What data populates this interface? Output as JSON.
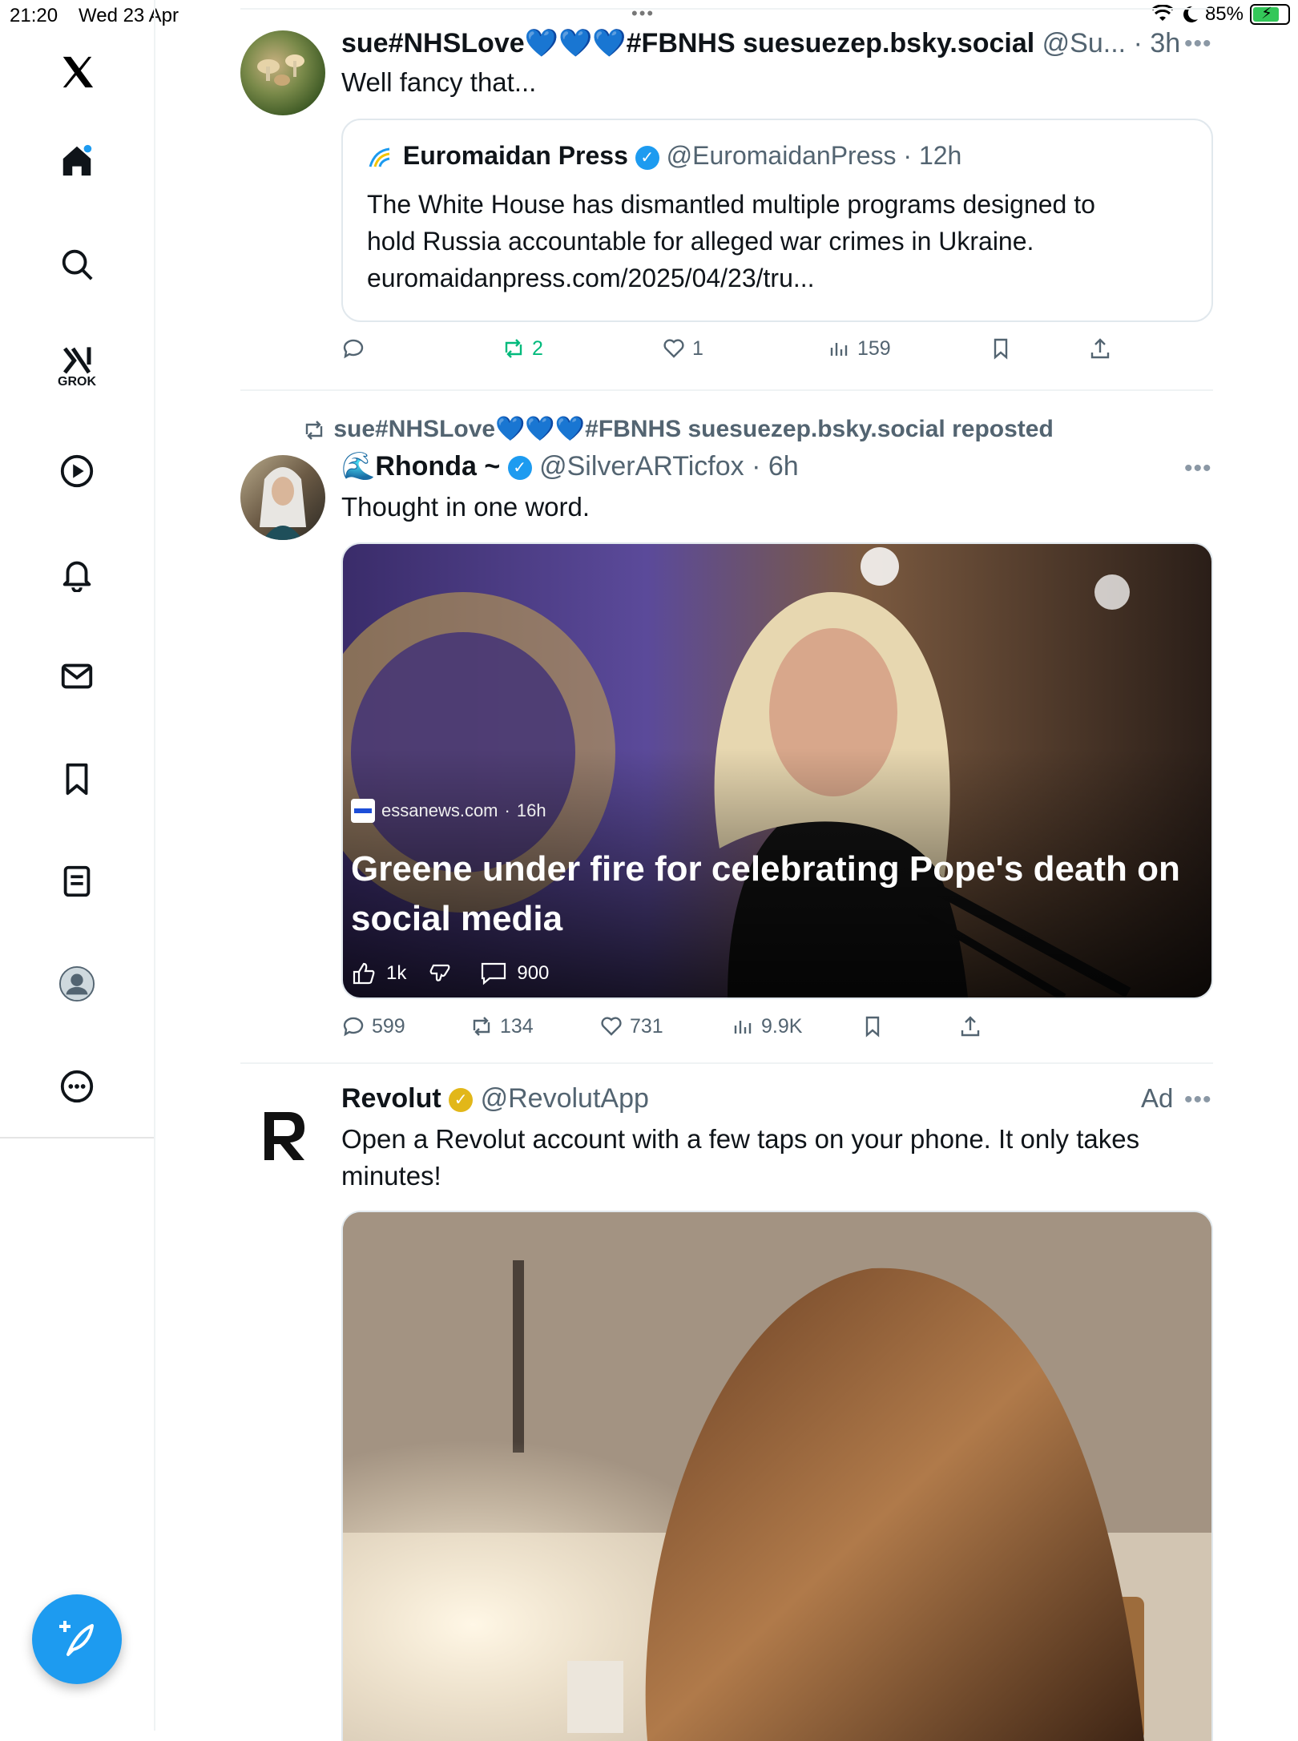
{
  "status_bar": {
    "time": "21:20",
    "date": "Wed 23 Apr",
    "battery": "85%",
    "battery_level": 0.85
  },
  "sidebar": {
    "grok_label": "GROK",
    "items": [
      {
        "icon": "x-logo-icon"
      },
      {
        "icon": "home-icon"
      },
      {
        "icon": "search-icon"
      },
      {
        "icon": "grok-icon"
      },
      {
        "icon": "video-play-icon"
      },
      {
        "icon": "notifications-bell-icon"
      },
      {
        "icon": "messages-mail-icon"
      },
      {
        "icon": "bookmark-icon"
      },
      {
        "icon": "lists-icon"
      },
      {
        "icon": "profile-avatar-icon"
      },
      {
        "icon": "more-icon"
      }
    ],
    "accent_color": "#1d9bf0"
  },
  "feed": {
    "tweet1": {
      "display_name": "sue#NHSLove💙💙💙#FBNHS suesuezep.bsky.social",
      "handle": "@Su...",
      "time": "3h",
      "text": "Well fancy that...",
      "quote": {
        "display_name": "Euromaidan Press",
        "handle": "@EuromaidanPress",
        "time": "12h",
        "text_line1": "The White House has dismantled multiple programs designed to",
        "text_line2": "hold Russia accountable for alleged war crimes in Ukraine.",
        "text_line3": "euromaidanpress.com/2025/04/23/tru..."
      },
      "reposts": "2",
      "likes": "1",
      "views": "159"
    },
    "tweet2": {
      "repost_label": "sue#NHSLove💙💙💙#FBNHS suesuezep.bsky.social reposted",
      "display_name": "Rhonda ~",
      "handle": "@SilverARTicfox",
      "time": "6h",
      "text": "Thought in one word.",
      "card": {
        "source": "essanews.com",
        "source_time": "16h",
        "headline_line1": "Greene under fire for celebrating Pope's death on",
        "headline_line2": "social media",
        "likes": "1k",
        "comments": "900"
      },
      "replies": "599",
      "reposts": "134",
      "likes": "731",
      "views": "9.9K"
    },
    "tweet3": {
      "display_name": "Revolut",
      "handle": "@RevolutApp",
      "ad_label": "Ad",
      "text_line1": "Open a Revolut account with a few taps on your phone. It only takes",
      "text_line2": "minutes!"
    }
  }
}
